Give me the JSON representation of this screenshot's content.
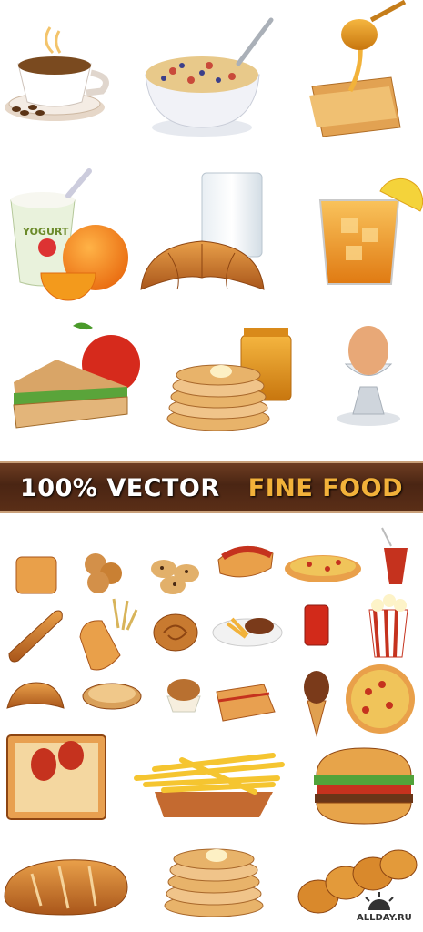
{
  "banner": {
    "left_text": "100% VECTOR",
    "right_text": "FINE FOOD"
  },
  "watermark": {
    "text": "ALLDAY.RU"
  },
  "items_top": [
    "coffee-cup",
    "cereal-bowl",
    "honey-toast",
    "yogurt-oranges",
    "croissant-milk",
    "iced-tea",
    "sandwich-apple",
    "pancakes-honey",
    "boiled-egg"
  ],
  "items_bottom": [
    "toast",
    "cookies",
    "chocolate-chip-cookies",
    "hotdog",
    "pizza",
    "soda-cup",
    "baguette",
    "bread-wheat",
    "cinnamon-roll",
    "steak-fries",
    "soda-can",
    "popcorn",
    "croissant",
    "pie",
    "muffin",
    "lasagna",
    "ice-cream-cone",
    "pizza-whole",
    "lasagna-plate",
    "french-fries",
    "hamburger",
    "bread-loaf",
    "pancakes",
    "braided-bread"
  ],
  "colors": {
    "banner_bg": "#4a2513",
    "banner_accent": "#f2b23a",
    "border": "#c9a07a"
  }
}
